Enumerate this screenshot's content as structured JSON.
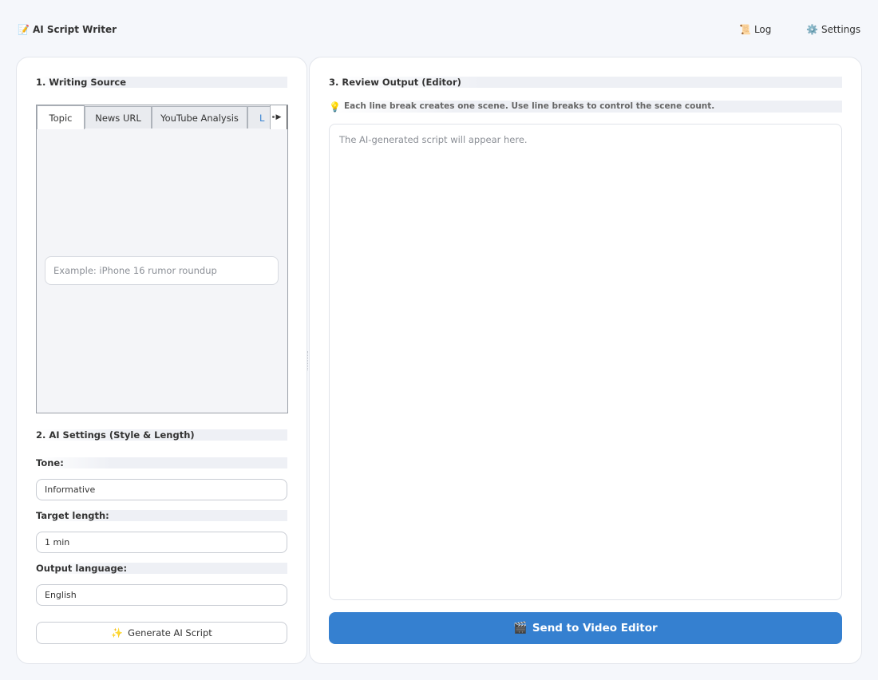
{
  "app": {
    "title": "AI Script Writer",
    "title_icon": "memo-icon",
    "log_label": "Log",
    "log_icon": "scroll-icon",
    "settings_label": "Settings",
    "settings_icon": "gear-icon"
  },
  "left": {
    "source_title": "1. Writing Source",
    "tabs": [
      {
        "label": "Topic",
        "active": true
      },
      {
        "label": "News URL",
        "active": false
      },
      {
        "label": "YouTube Analysis",
        "active": false
      },
      {
        "label": "L",
        "active": false
      }
    ],
    "topic_placeholder": "Example: iPhone 16 rumor roundup",
    "ai_settings_title": "2. AI Settings (Style & Length)",
    "tone_label": "Tone:",
    "tone_value": "Informative",
    "length_label": "Target length:",
    "length_value": "1 min",
    "language_label": "Output language:",
    "language_value": "English",
    "generate_label": "Generate AI Script",
    "generate_icon": "sparkles-icon"
  },
  "right": {
    "review_title": "3. Review Output (Editor)",
    "hint_icon": "lightbulb-icon",
    "hint_text": "Each line break creates one scene. Use line breaks to control the scene count.",
    "editor_placeholder": "The AI-generated script will appear here.",
    "send_label": "Send to Video Editor",
    "send_icon": "clapperboard-icon"
  },
  "colors": {
    "accent": "#3580d0",
    "background": "#f5f7fb"
  }
}
